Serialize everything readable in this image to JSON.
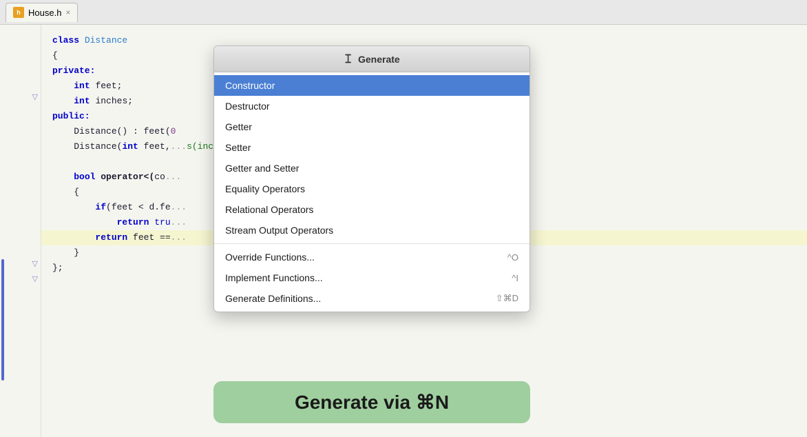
{
  "tab": {
    "icon_label": "h",
    "filename": "House.h",
    "close": "×"
  },
  "popup": {
    "header_cursor": "𝙸",
    "header_title": "Generate",
    "items": [
      {
        "label": "Constructor",
        "shortcut": "",
        "selected": true
      },
      {
        "label": "Destructor",
        "shortcut": "",
        "selected": false
      },
      {
        "label": "Getter",
        "shortcut": "",
        "selected": false
      },
      {
        "label": "Setter",
        "shortcut": "",
        "selected": false
      },
      {
        "label": "Getter and Setter",
        "shortcut": "",
        "selected": false
      },
      {
        "label": "Equality Operators",
        "shortcut": "",
        "selected": false
      },
      {
        "label": "Relational Operators",
        "shortcut": "",
        "selected": false
      },
      {
        "label": "Stream Output Operators",
        "shortcut": "",
        "selected": false
      }
    ],
    "items_with_shortcuts": [
      {
        "label": "Override Functions...",
        "shortcut": "^O"
      },
      {
        "label": "Implement Functions...",
        "shortcut": "^I"
      },
      {
        "label": "Generate Definitions...",
        "shortcut": "⇧⌘D"
      }
    ]
  },
  "generate_bar": {
    "text_bold": "Generate",
    "text_rest": " via ⌘N"
  }
}
